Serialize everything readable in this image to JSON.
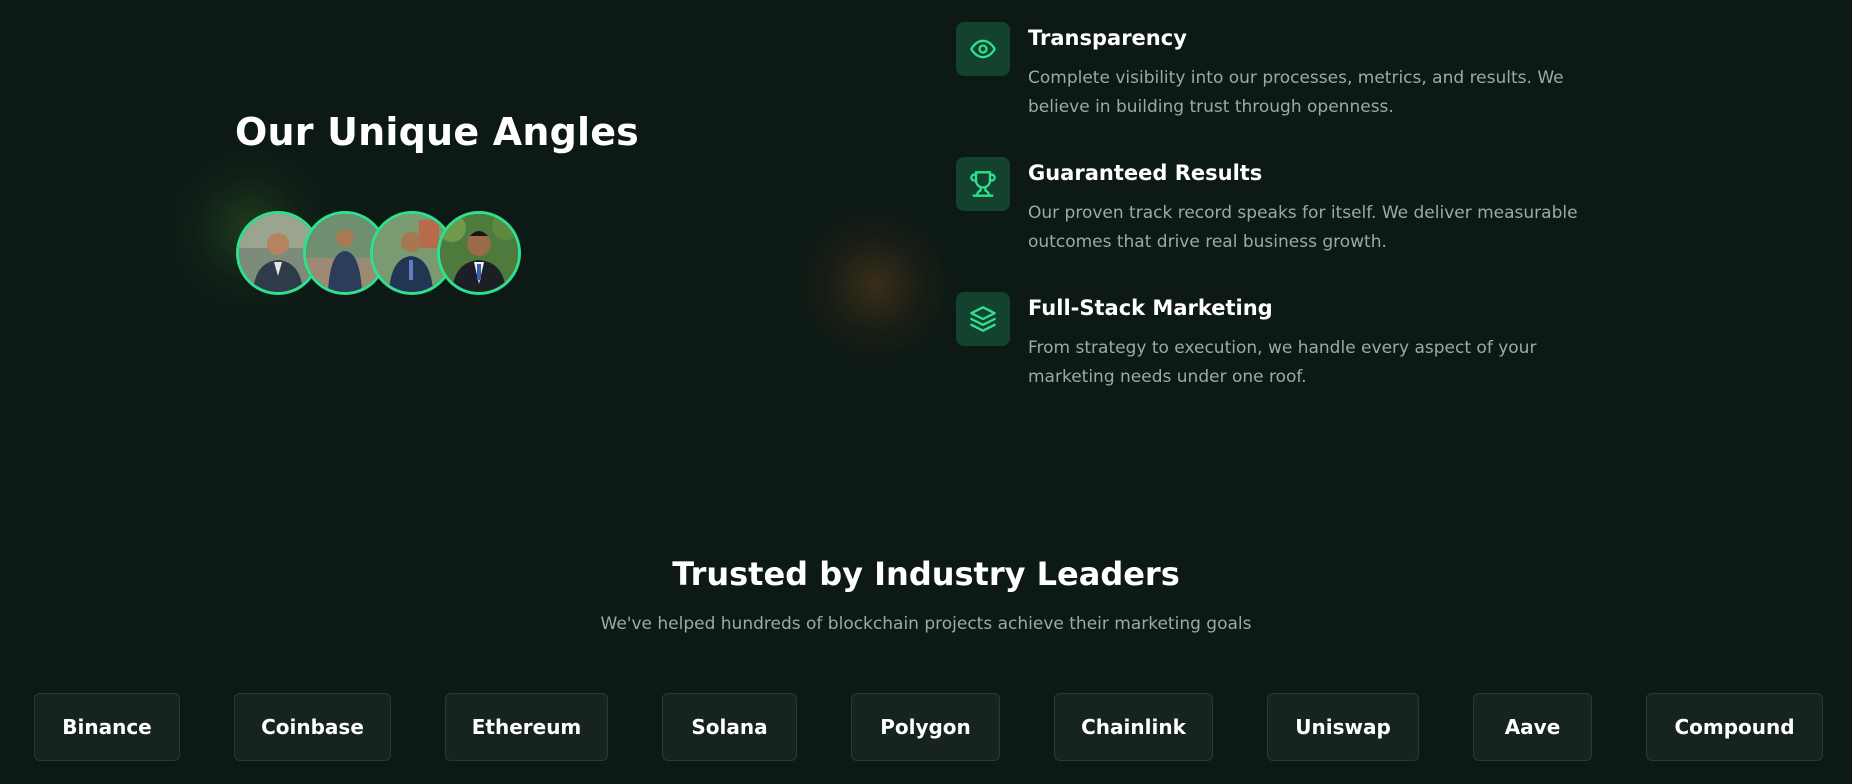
{
  "left": {
    "title": "Our Unique Angles",
    "avatars": [
      "team-member-1",
      "team-member-2",
      "team-member-3",
      "team-member-4"
    ]
  },
  "features": [
    {
      "icon": "eye-icon",
      "title": "Transparency",
      "description": "Complete visibility into our processes, metrics, and results. We believe in building trust through openness."
    },
    {
      "icon": "trophy-icon",
      "title": "Guaranteed Results",
      "description": "Our proven track record speaks for itself. We deliver measurable outcomes that drive real business growth."
    },
    {
      "icon": "layers-icon",
      "title": "Full-Stack Marketing",
      "description": "From strategy to execution, we handle every aspect of your marketing needs under one roof."
    }
  ],
  "trusted": {
    "title": "Trusted by Industry Leaders",
    "subtitle": "We've helped hundreds of blockchain projects achieve their marketing goals",
    "partners": [
      "Binance",
      "Coinbase",
      "Ethereum",
      "Solana",
      "Polygon",
      "Chainlink",
      "Uniswap",
      "Aave",
      "Compound"
    ]
  },
  "colors": {
    "background": "#0c1915",
    "accent": "#2fe08d",
    "icon_tile": "#13422e",
    "muted_text": "#9fa9a4",
    "partner_card": "#16231f"
  }
}
